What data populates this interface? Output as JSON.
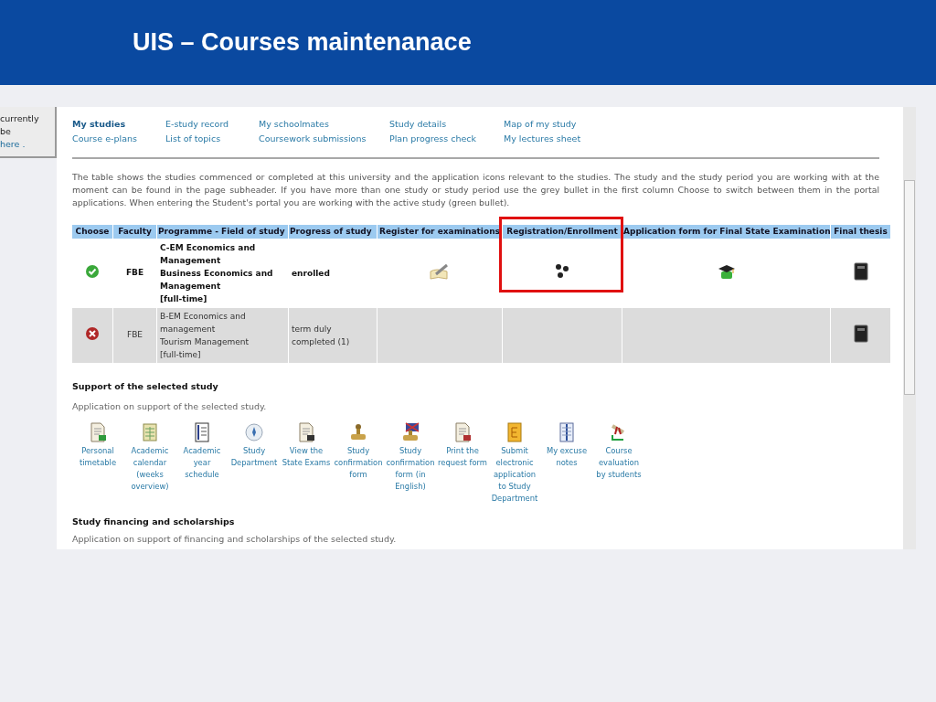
{
  "slide": {
    "title": "UIS – Courses maintenanace"
  },
  "side_tab": {
    "lines": [
      "currently be",
      "here ."
    ]
  },
  "nav": [
    {
      "label": "My studies",
      "selected": true
    },
    {
      "label": "E-study record",
      "selected": false
    },
    {
      "label": "My schoolmates",
      "selected": false
    },
    {
      "label": "Study details",
      "selected": false
    },
    {
      "label": "Map of my study",
      "selected": false
    },
    {
      "label": "Course e-plans",
      "selected": false
    },
    {
      "label": "List of topics",
      "selected": false
    },
    {
      "label": "Coursework submissions",
      "selected": false
    },
    {
      "label": "Plan progress check",
      "selected": false
    },
    {
      "label": "My lectures sheet",
      "selected": false
    }
  ],
  "intro": "The table shows the studies commenced or completed at this university and the application icons relevant to the studies. The study and the study period you are working with at the moment can be found in the page subheader. If you have more than one study or study period use the grey bullet in the first column Choose to switch between them in the portal applications. When entering the Student's portal you are working with the active study (green bullet).",
  "table": {
    "columns": [
      "Choose",
      "Faculty",
      "Programme - Field of study",
      "Progress of study",
      "Register for examinations",
      "Registration/Enrollment",
      "Application form for Final State Examination",
      "Final thesis"
    ],
    "rows": [
      {
        "active": true,
        "faculty": "FBE",
        "programme": [
          "C-EM Economics and Management",
          "Business Economics and Management",
          "[full-time]"
        ],
        "progress": "enrolled",
        "exam_registration": true,
        "enrollment": true,
        "final_exam_application": true,
        "final_thesis": true
      },
      {
        "active": false,
        "faculty": "FBE",
        "programme": [
          "B-EM Economics and management",
          "Tourism Management",
          "[full-time]"
        ],
        "progress": "term duly completed (1)",
        "exam_registration": false,
        "enrollment": false,
        "final_exam_application": false,
        "final_thesis": true
      }
    ]
  },
  "support": {
    "heading": "Support of the selected study",
    "description": "Application on support of the selected study.",
    "items": [
      {
        "kind": "timetable",
        "label": "Personal timetable"
      },
      {
        "kind": "calendar",
        "label": "Academic calendar (weeks overview)"
      },
      {
        "kind": "schedule",
        "label": "Academic year schedule"
      },
      {
        "kind": "compass",
        "label": "Study Department"
      },
      {
        "kind": "exam",
        "label": "View the State Exams"
      },
      {
        "kind": "stamp",
        "label": "Study confirmation form"
      },
      {
        "kind": "stamp-flag",
        "label": "Study confirmation form (in English)"
      },
      {
        "kind": "print",
        "label": "Print the request form"
      },
      {
        "kind": "submit",
        "label": "Submit electronic application to Study Department"
      },
      {
        "kind": "notes",
        "label": "My excuse notes"
      },
      {
        "kind": "evaluation",
        "label": "Course evaluation by students"
      }
    ]
  },
  "financing": {
    "heading": "Study financing and scholarships",
    "description": "Application on support of financing and scholarships of the selected study."
  }
}
